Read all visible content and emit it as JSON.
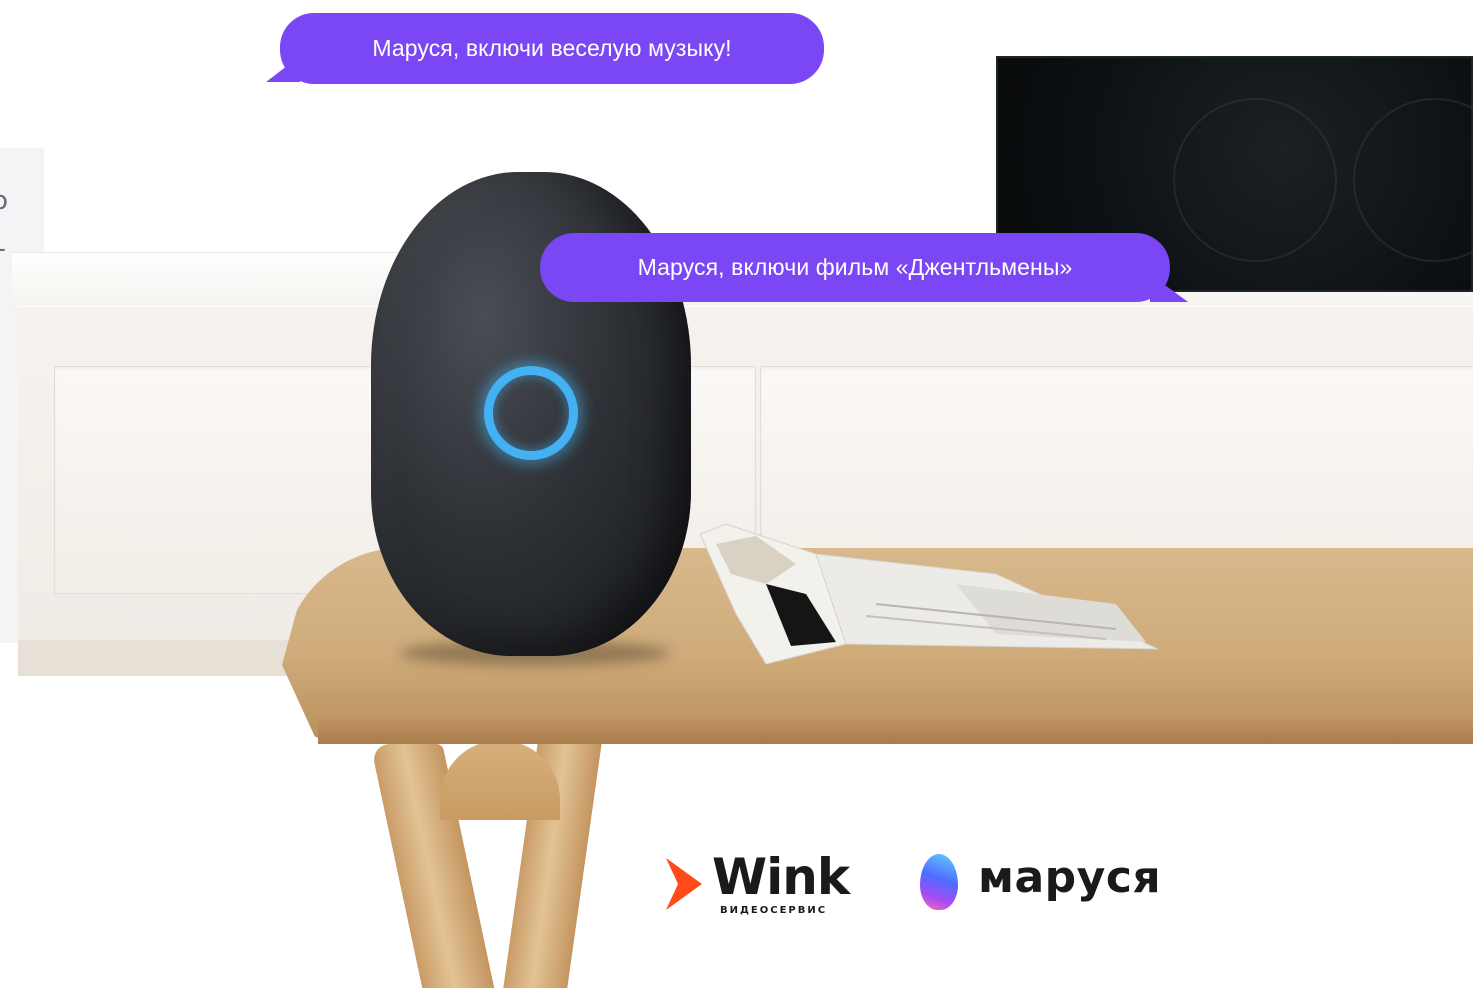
{
  "left_panel": {
    "fragment_1": "o",
    "fragment_2": "-"
  },
  "bubbles": {
    "music_command": "Маруся, включи веселую музыку!",
    "movie_command": "Маруся, включи фильм «Джентльмены»"
  },
  "logos": {
    "wink": {
      "word": "Wink",
      "subtitle": "ВИДЕОСЕРВИС"
    },
    "marusya": {
      "word": "маруся"
    }
  },
  "colors": {
    "bubble": "#7b47f4",
    "speaker_ring": "#44b2f2",
    "wink_arrow": "#ff4a1c"
  }
}
